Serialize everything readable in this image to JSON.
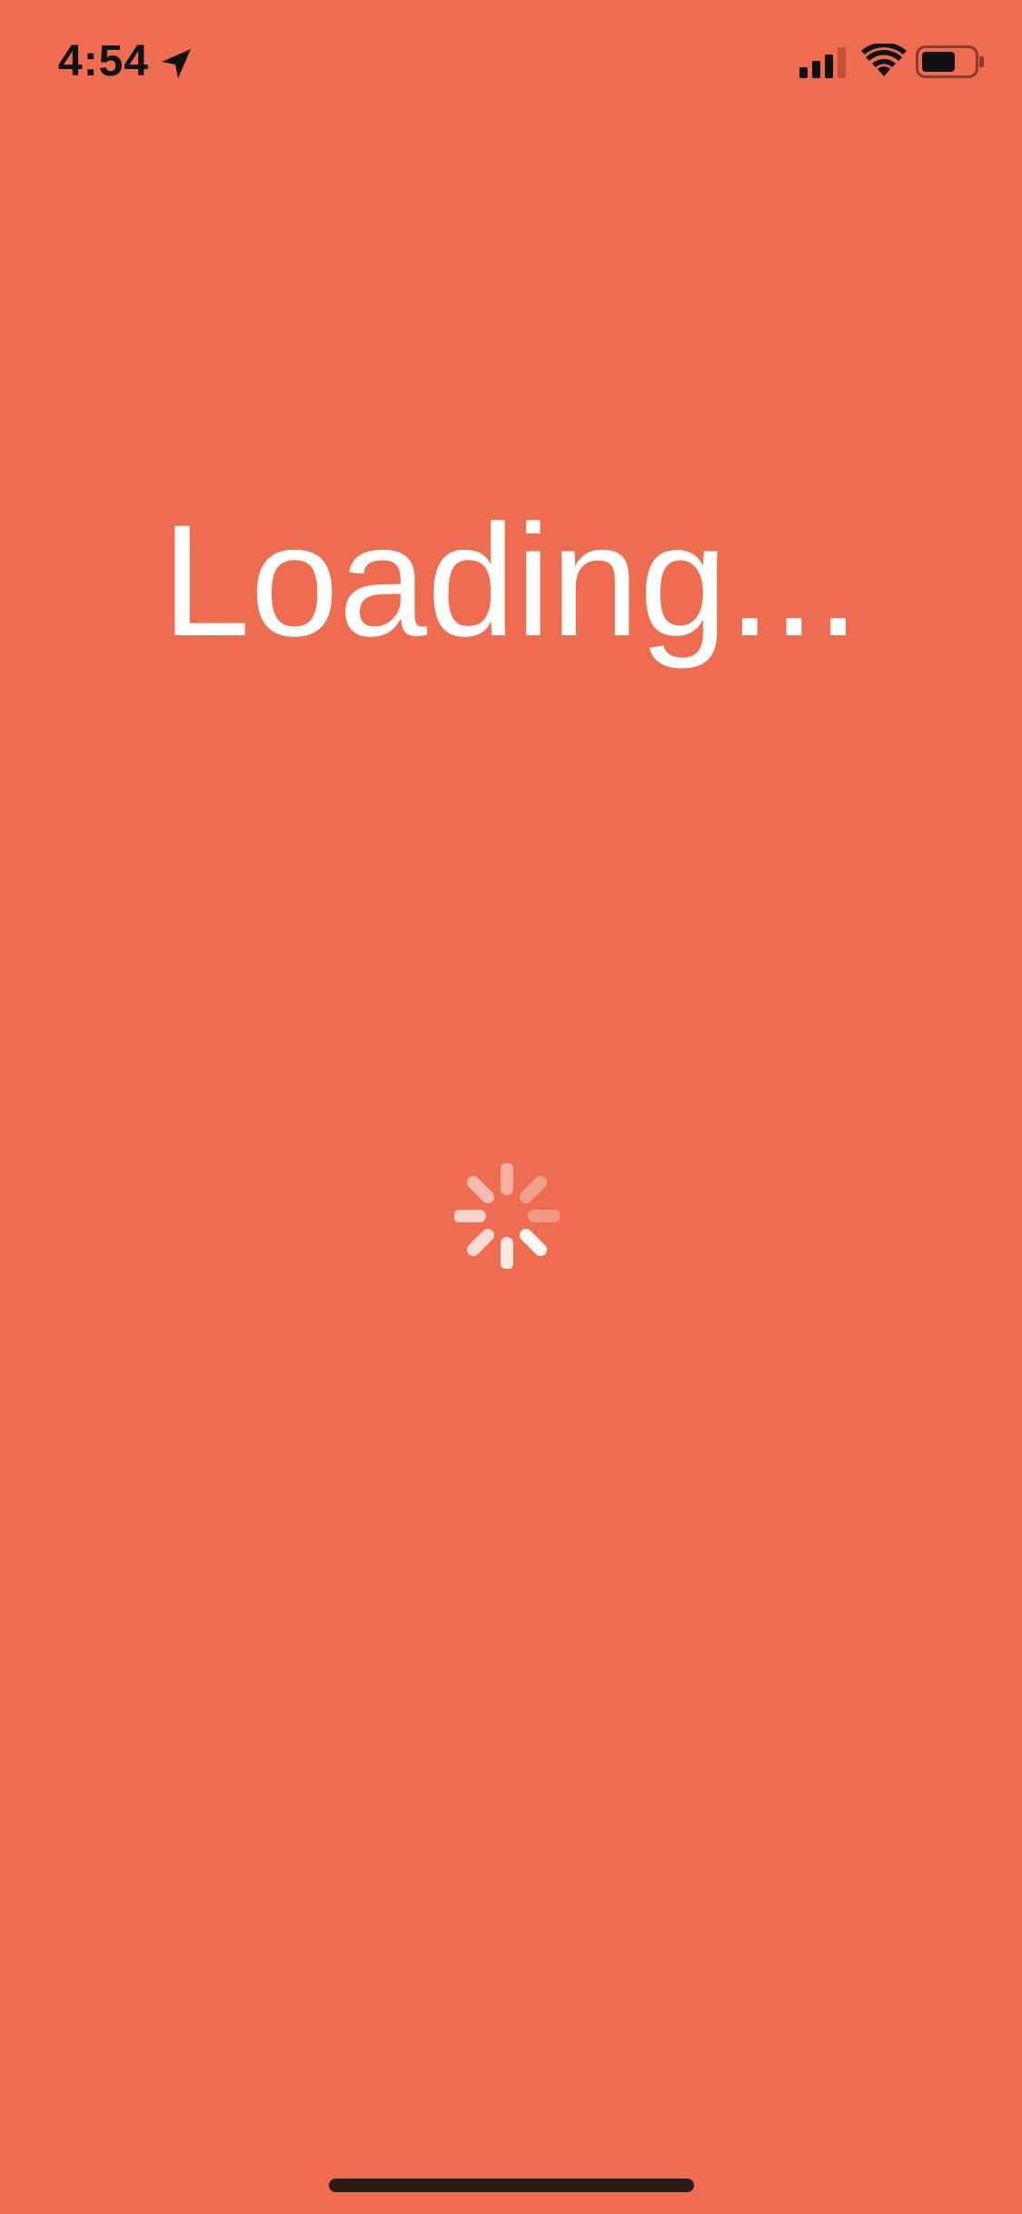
{
  "status_bar": {
    "time": "4:54",
    "location_icon": "location-arrow-icon",
    "signal_icon": "cellular-signal-icon",
    "wifi_icon": "wifi-icon",
    "battery_icon": "battery-icon",
    "signal_bars_filled": 3,
    "signal_bars_total": 4,
    "battery_level": 0.65
  },
  "main": {
    "title": "Loading...",
    "spinner_icon": "activity-spinner-icon"
  },
  "colors": {
    "background": "#EE6C50",
    "text": "#FFFFFF",
    "status_text": "#111111"
  }
}
